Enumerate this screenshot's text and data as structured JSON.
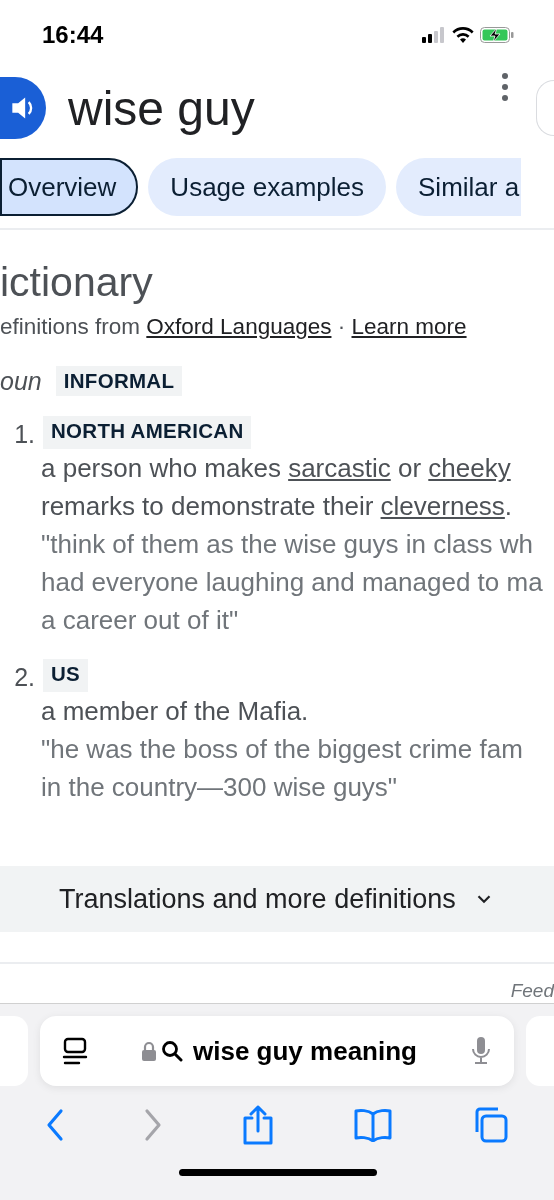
{
  "status_bar": {
    "time": "16:44"
  },
  "header": {
    "title": "wise guy"
  },
  "tabs": [
    {
      "label": "Overview",
      "selected": true
    },
    {
      "label": "Usage examples",
      "selected": false
    },
    {
      "label": "Similar a",
      "selected": false
    }
  ],
  "dictionary": {
    "heading": "ictionary",
    "source_prefix": "efinitions from",
    "source_link": "Oxford Languages",
    "separator": "·",
    "learn_more": "Learn more",
    "part_of_speech": "oun",
    "register": "INFORMAL",
    "senses": [
      {
        "number": "1.",
        "label": "NORTH AMERICAN",
        "definition": [
          {
            "text": "a person who makes "
          },
          {
            "link": "sarcastic"
          },
          {
            "text": " or "
          },
          {
            "link": "cheeky"
          },
          {
            "text": " remarks to demonstrate their "
          },
          {
            "link": "cleverness"
          },
          {
            "text": "."
          }
        ],
        "example_lines": [
          "\"think of them as the wise guys in class wh",
          "had everyone laughing and managed to ma",
          "a career out of it\""
        ]
      },
      {
        "number": "2.",
        "label": "US",
        "definition": [
          {
            "text": "a member of the Mafia."
          }
        ],
        "example_lines": [
          "\"he was the boss of the biggest crime fam",
          "in the country—300 wise guys\""
        ]
      }
    ]
  },
  "more_button": {
    "label": "Translations and more definitions"
  },
  "feedback": "Feed",
  "browser": {
    "address": "wise guy meaning"
  }
}
